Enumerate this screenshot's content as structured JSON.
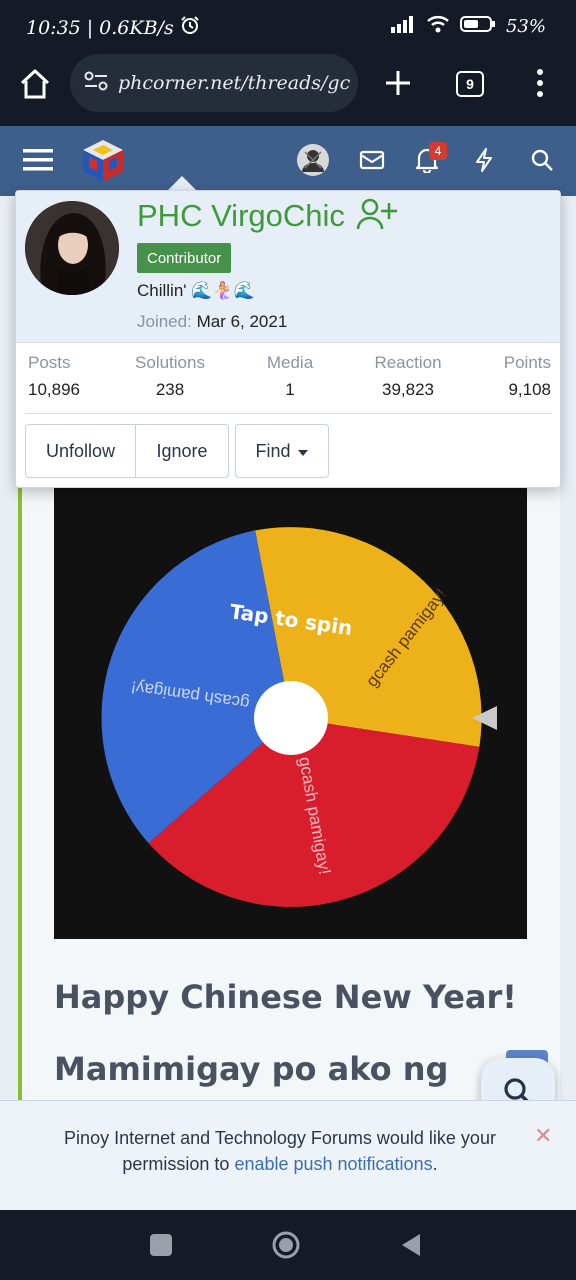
{
  "status_bar": {
    "time": "10:35",
    "speed": "0.6KB/s",
    "battery": "53%"
  },
  "browser": {
    "url": "phcorner.net/threads/gcash-pamigay",
    "tab_count": "9"
  },
  "header": {
    "notification_count": "4"
  },
  "member_card": {
    "name": "PHC VirgoChic",
    "role": "Contributor",
    "status": "Chillin' 🌊🧜‍♀️🌊",
    "joined_label": "Joined:",
    "joined_date": "Mar 6, 2021",
    "stats": [
      {
        "label": "Posts",
        "value": "10,896"
      },
      {
        "label": "Solutions",
        "value": "238"
      },
      {
        "label": "Media",
        "value": "1"
      },
      {
        "label": "Reaction",
        "value": "39,823"
      },
      {
        "label": "Points",
        "value": "9,108"
      }
    ],
    "actions": {
      "unfollow": "Unfollow",
      "ignore": "Ignore",
      "find": "Find"
    }
  },
  "wheel": {
    "center_label": "Tap to spin",
    "segments": [
      {
        "label": "gcash pamigay!",
        "color": "#EDB11A"
      },
      {
        "label": "gcash pamigay!",
        "color": "#D81E2C"
      },
      {
        "label": "gcash pamigay!",
        "color": "#3A6CD6"
      }
    ]
  },
  "post": {
    "line1": "Happy Chinese New Year!",
    "line2": "Mamimigay po ako ng"
  },
  "push_banner": {
    "text_before": "Pinoy Internet and Technology Forums would like your permission to ",
    "link_text": "enable push notifications",
    "text_after": ".",
    "close": "✕"
  },
  "colors": {
    "header": "#3e5f8c",
    "name_green": "#3f9a3a",
    "accent_green": "#8bbf32"
  }
}
